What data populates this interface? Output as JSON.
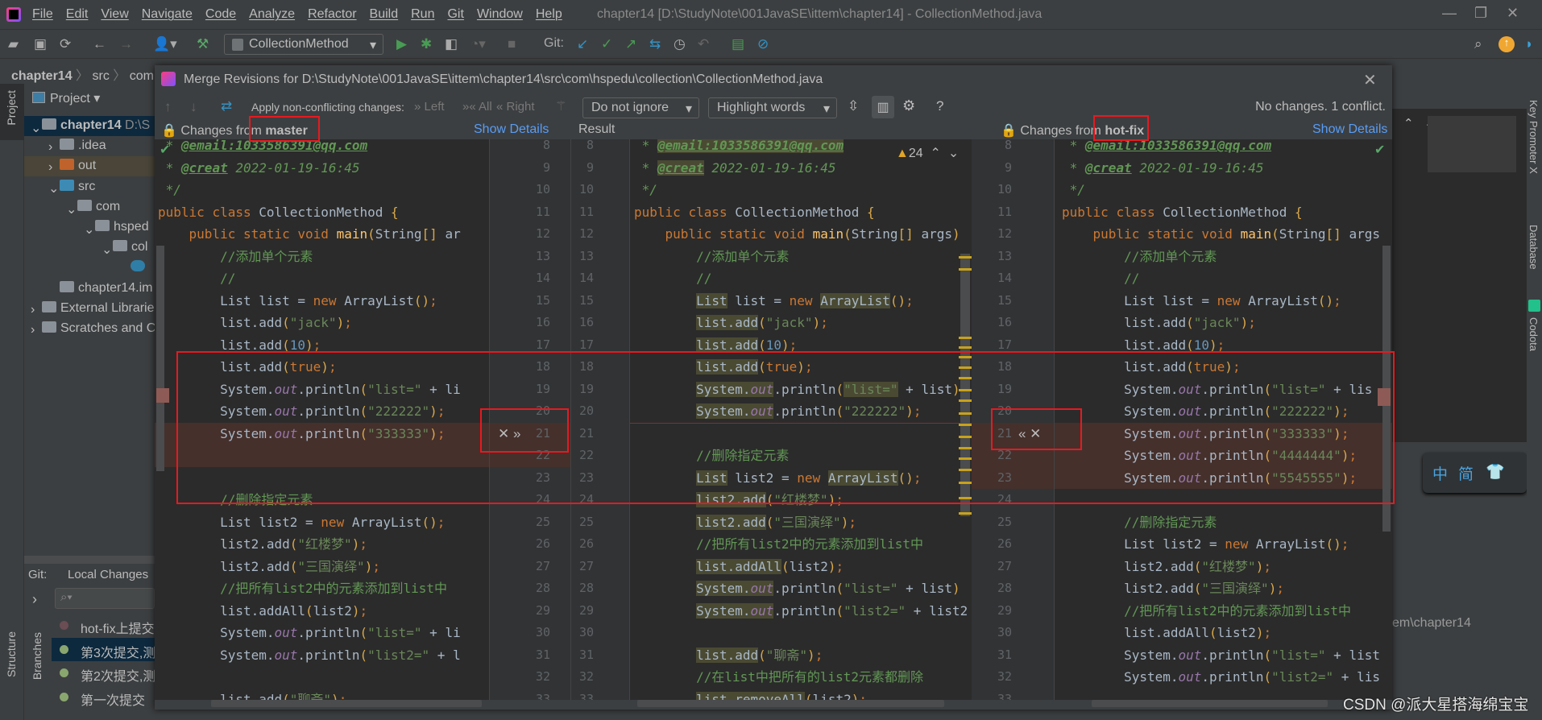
{
  "window": {
    "title": "chapter14 [D:\\StudyNote\\001JavaSE\\ittem\\chapter14] - CollectionMethod.java"
  },
  "menu": [
    "File",
    "Edit",
    "View",
    "Navigate",
    "Code",
    "Analyze",
    "Refactor",
    "Build",
    "Run",
    "Git",
    "Window",
    "Help"
  ],
  "toolbar": {
    "run_config": "CollectionMethod",
    "git_label": "Git:"
  },
  "breadcrumb": [
    "chapter14",
    "src",
    "com"
  ],
  "project_panel": {
    "title": "Project",
    "strip_label": "Project",
    "items": [
      {
        "label": "chapter14",
        "extra": "D:\\S",
        "depth": 0,
        "expanded": true,
        "selected": true
      },
      {
        "label": ".idea",
        "depth": 1,
        "expanded": false
      },
      {
        "label": "out",
        "depth": 1,
        "expanded": false
      },
      {
        "label": "src",
        "depth": 1,
        "expanded": true
      },
      {
        "label": "com",
        "depth": 2,
        "expanded": true
      },
      {
        "label": "hsped",
        "depth": 3,
        "expanded": true
      },
      {
        "label": "col",
        "depth": 4,
        "expanded": true
      },
      {
        "label": "",
        "depth": 5,
        "icon": "java-class-icon"
      },
      {
        "label": "chapter14.im",
        "depth": 1
      },
      {
        "label": "External Librarie",
        "depth": 0,
        "expanded": false
      },
      {
        "label": "Scratches and C",
        "depth": 0,
        "expanded": false
      }
    ]
  },
  "git_panel": {
    "label": "Git:",
    "tab": "Local Changes",
    "branches_label": "Branches",
    "structure_label": "Structure",
    "commits": [
      "hot-fix上提交",
      "第3次提交,测",
      "第2次提交,测",
      "第一次提交"
    ],
    "selected_commit": 1
  },
  "dialog": {
    "title": "Merge Revisions for D:\\StudyNote\\001JavaSE\\ittem\\chapter14\\src\\com\\hspedu\\collection\\CollectionMethod.java",
    "apply_label": "Apply non-conflicting changes:",
    "apply_left": "Left",
    "apply_all": "All",
    "apply_right": "Right",
    "ignore_dropdown": "Do not ignore",
    "highlight_dropdown": "Highlight words",
    "status": "No changes. 1 conflict.",
    "left_header_prefix": "Changes from",
    "left_branch": "master",
    "show_details": "Show Details",
    "result_header": "Result",
    "right_header_prefix": "Changes from",
    "right_branch": "hot-fix",
    "warning_count": "24",
    "first_line": 8
  },
  "left_lines": [
    " * @email:1033586391@qq.com",
    " * @creat 2022-01-19-16:45",
    " */",
    "public class CollectionMethod {",
    "    public static void main(String[] ar",
    "        //添加单个元素",
    "        //",
    "        List list = new ArrayList();",
    "        list.add(\"jack\");",
    "        list.add(10);",
    "        list.add(true);",
    "        System.out.println(\"list=\" + li",
    "        System.out.println(\"222222\");",
    "        System.out.println(\"333333\");",
    "",
    "",
    "        //删除指定元素",
    "        List list2 = new ArrayList();",
    "        list2.add(\"红楼梦\");",
    "        list2.add(\"三国演绎\");",
    "        //把所有list2中的元素添加到list中",
    "        list.addAll(list2);",
    "        System.out.println(\"list=\" + li",
    "        System.out.println(\"list2=\" + l",
    "",
    "        list.add(\"聊斋\");"
  ],
  "result_lines": [
    {
      "t": " * @email:1033586391@qq.com",
      "hl": [
        "@email:1033586391@qq.com"
      ]
    },
    {
      "t": " * @creat 2022-01-19-16:45",
      "hl": [
        "@creat"
      ]
    },
    {
      "t": " */",
      "hl": []
    },
    {
      "t": "public class CollectionMethod {",
      "hl": []
    },
    {
      "t": "    public static void main(String[] args)",
      "hl": []
    },
    {
      "t": "        //添加单个元素",
      "hl": []
    },
    {
      "t": "        //",
      "hl": []
    },
    {
      "t": "        List list = new ArrayList();",
      "hl": [
        "List",
        "ArrayList"
      ]
    },
    {
      "t": "        list.add(\"jack\");",
      "hl": [
        "list.add"
      ]
    },
    {
      "t": "        list.add(10);",
      "hl": [
        "list.add"
      ]
    },
    {
      "t": "        list.add(true);",
      "hl": [
        "list.add"
      ]
    },
    {
      "t": "        System.out.println(\"list=\" + list)",
      "hl": [
        "System.out",
        "\"list=\""
      ]
    },
    {
      "t": "        System.out.println(\"222222\");",
      "hl": [
        "System.out"
      ]
    },
    {
      "t": "",
      "hl": []
    },
    {
      "t": "        //删除指定元素",
      "hl": []
    },
    {
      "t": "        List list2 = new ArrayList();",
      "hl": [
        "List",
        "ArrayList"
      ]
    },
    {
      "t": "        list2.add(\"红楼梦\");",
      "hl": [
        "list2.add"
      ]
    },
    {
      "t": "        list2.add(\"三国演绎\");",
      "hl": [
        "list2.add"
      ]
    },
    {
      "t": "        //把所有list2中的元素添加到list中",
      "hl": []
    },
    {
      "t": "        list.addAll(list2);",
      "hl": [
        "list.addAll"
      ]
    },
    {
      "t": "        System.out.println(\"list=\" + list)",
      "hl": [
        "System.out"
      ]
    },
    {
      "t": "        System.out.println(\"list2=\" + list2",
      "hl": [
        "System.out"
      ]
    },
    {
      "t": "",
      "hl": []
    },
    {
      "t": "        list.add(\"聊斋\");",
      "hl": [
        "list.add"
      ]
    },
    {
      "t": "        //在list中把所有的list2元素都删除",
      "hl": []
    },
    {
      "t": "        list.removeAll(list2);",
      "hl": [
        "list.removeAll"
      ]
    }
  ],
  "right_lines": [
    " * @email:1033586391@qq.com",
    " * @creat 2022-01-19-16:45",
    " */",
    "public class CollectionMethod {",
    "    public static void main(String[] args",
    "        //添加单个元素",
    "        //",
    "        List list = new ArrayList();",
    "        list.add(\"jack\");",
    "        list.add(10);",
    "        list.add(true);",
    "        System.out.println(\"list=\" + lis",
    "        System.out.println(\"222222\");",
    "        System.out.println(\"333333\");",
    "        System.out.println(\"4444444\");",
    "        System.out.println(\"5545555\");",
    "",
    "        //删除指定元素",
    "        List list2 = new ArrayList();",
    "        list2.add(\"红楼梦\");",
    "        list2.add(\"三国演绎\");",
    "        //把所有list2中的元素添加到list中",
    "        list.addAll(list2);",
    "        System.out.println(\"list=\" + list",
    "        System.out.println(\"list2=\" + lis",
    ""
  ],
  "conflict": {
    "left_lines": [
      21,
      22
    ],
    "result_line": 21,
    "right_lines": [
      21,
      22,
      23
    ]
  },
  "right_ide": {
    "tool_windows": [
      "Key Promoter X",
      "Database",
      "Codota"
    ],
    "path_fragment": "em\\chapter14",
    "ime": [
      "中",
      "简"
    ]
  },
  "watermark": "CSDN @派大星搭海绵宝宝",
  "colors": {
    "conflict": "#45302c",
    "highlight": "#4a4a33",
    "accent_link": "#589df6",
    "annotation_box": "#e8191f"
  }
}
